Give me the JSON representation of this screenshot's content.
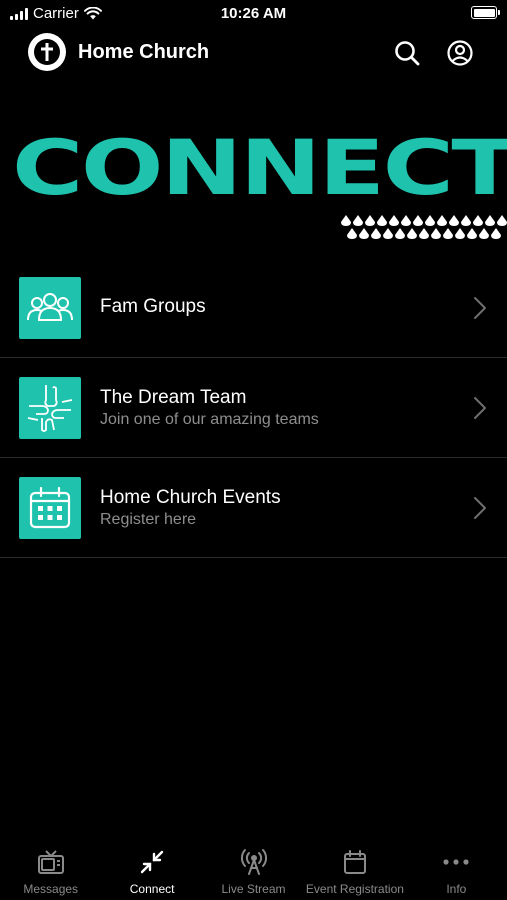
{
  "status_bar": {
    "carrier": "Carrier",
    "time": "10:26 AM"
  },
  "header": {
    "title": "Home Church",
    "logo_icon": "cross-logo-icon",
    "actions": [
      "search-icon",
      "account-icon"
    ]
  },
  "hero": {
    "title": "CONNECT"
  },
  "list": {
    "items": [
      {
        "title": "Fam Groups",
        "subtitle": "",
        "icon": "group-people-icon"
      },
      {
        "title": "The Dream Team",
        "subtitle": "Join one of our amazing teams",
        "icon": "hands-together-icon"
      },
      {
        "title": "Home Church Events",
        "subtitle": "Register here",
        "icon": "calendar-icon"
      }
    ]
  },
  "tab_bar": {
    "tabs": [
      {
        "label": "Messages",
        "icon": "tv-icon",
        "active": false
      },
      {
        "label": "Connect",
        "icon": "connect-arrows-icon",
        "active": true
      },
      {
        "label": "Live Stream",
        "icon": "broadcast-icon",
        "active": false
      },
      {
        "label": "Event Registration",
        "icon": "calendar-icon",
        "active": false
      },
      {
        "label": "Info",
        "icon": "more-dots-icon",
        "active": false
      }
    ]
  },
  "colors": {
    "accent": "#1ec2ad",
    "background": "#000000",
    "text_primary": "#ffffff",
    "text_secondary": "#8e8e8e",
    "tab_inactive": "#8a8a8a"
  }
}
